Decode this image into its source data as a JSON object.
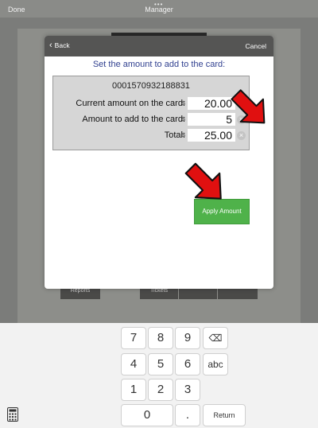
{
  "top_bar": {
    "left_button": "Done",
    "title": "Manager",
    "dots": "•••"
  },
  "background_buttons": {
    "left": "Reports",
    "right": "Tickets"
  },
  "modal": {
    "back_label": "Back",
    "cancel_label": "Cancel",
    "subtitle": "Set the amount to add to the card:",
    "card_number": "0001570932188831",
    "rows": [
      {
        "label": "Current amount on the card:",
        "currency": "$",
        "value": "20.00"
      },
      {
        "label": "Amount to add to the card:",
        "currency": "$",
        "value": "5"
      },
      {
        "label": "Total:",
        "currency": "$",
        "value": "25.00"
      }
    ],
    "apply_label": "Apply Amount"
  },
  "keypad": {
    "keys": [
      "7",
      "8",
      "9",
      "⌫",
      "4",
      "5",
      "6",
      "abc",
      "1",
      "2",
      "3",
      "0",
      ".",
      "Return"
    ]
  },
  "colors": {
    "accent_green": "#4fb24a",
    "subtitle_blue": "#2f3f8f",
    "arrow_red": "#e01010"
  },
  "icons": {
    "calculator": "calculator-icon",
    "backspace": "backspace-icon",
    "clear": "clear-icon"
  }
}
